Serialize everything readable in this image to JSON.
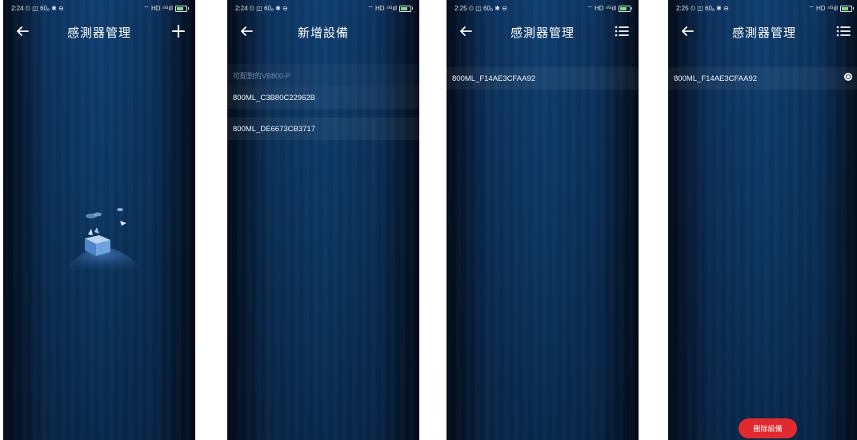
{
  "colors": {
    "background": "#0c3864",
    "accent_red": "#e02a2f",
    "text": "#ffffff",
    "muted": "#6f8aa6"
  },
  "screens": [
    {
      "status": {
        "time": "2:24 ⏲ ◫ 60ₐ ✱ ⊖",
        "right": "⌔ HD ⁴ᴳıll"
      },
      "title": "感測器管理",
      "action_icon": "plus-icon",
      "illustration": "empty-box-illustration"
    },
    {
      "status": {
        "time": "2:24 ⏲ ◫ 60ₐ ✱ ⊖",
        "right": "⌔ HD ⁴ᴳıll"
      },
      "title": "新增設備",
      "section_label": "可配對的VB800-P",
      "devices": [
        "800ML_C3B80C22962B",
        "800ML_DE6673CB3717"
      ]
    },
    {
      "status": {
        "time": "2:25 ⏲ ◫ 60ₐ ✱ ⊖",
        "right": "⌔ HD ⁴ᴳıll"
      },
      "title": "感測器管理",
      "action_icon": "list-menu-icon",
      "devices": [
        "800ML_F14AE3CFAA92"
      ]
    },
    {
      "status": {
        "time": "2:25 ⏲ ◫ 60ₐ ✱ ⊖",
        "right": "⌔ HD ⁴ᴳıll"
      },
      "title": "感測器管理",
      "action_icon": "list-menu-icon",
      "devices": [
        "800ML_F14AE3CFAA92"
      ],
      "delete_label": "刪除設備"
    }
  ]
}
